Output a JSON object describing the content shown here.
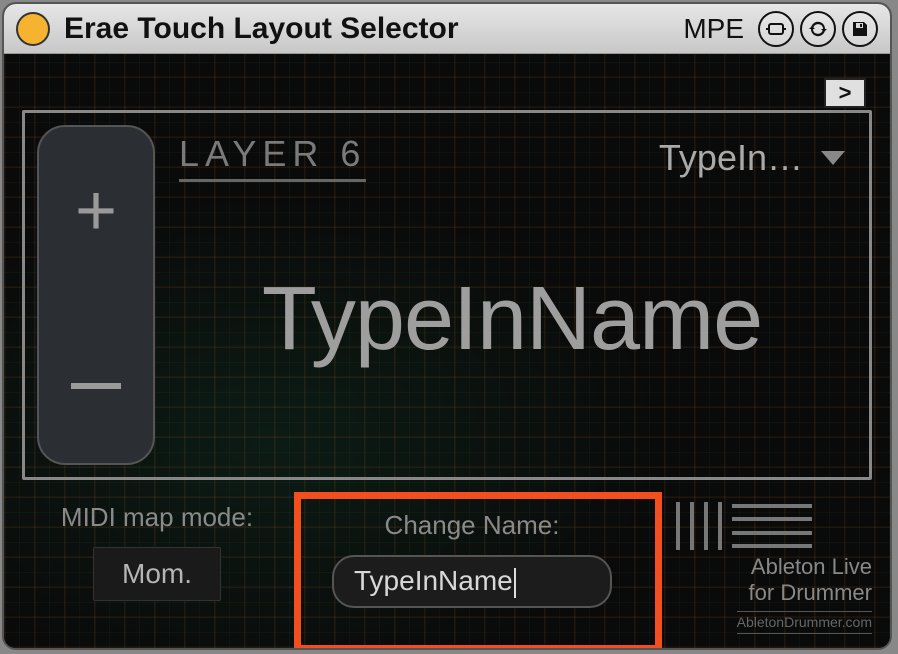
{
  "titlebar": {
    "title": "Erae Touch Layout Selector",
    "mpe_label": "MPE"
  },
  "expand_glyph": ">",
  "main": {
    "layer_label": "LAYER 6",
    "dropdown_value": "TypeIn…",
    "big_name": "TypeInName"
  },
  "midi": {
    "label": "MIDI map mode:",
    "button": "Mom."
  },
  "change_name": {
    "label": "Change Name:",
    "value": "TypeInName"
  },
  "stepper": {
    "plus": "+",
    "minus": "–"
  },
  "logo": {
    "line1": "Ableton Live",
    "line2": "for Drummer",
    "small": "AbletonDrummer.com"
  }
}
